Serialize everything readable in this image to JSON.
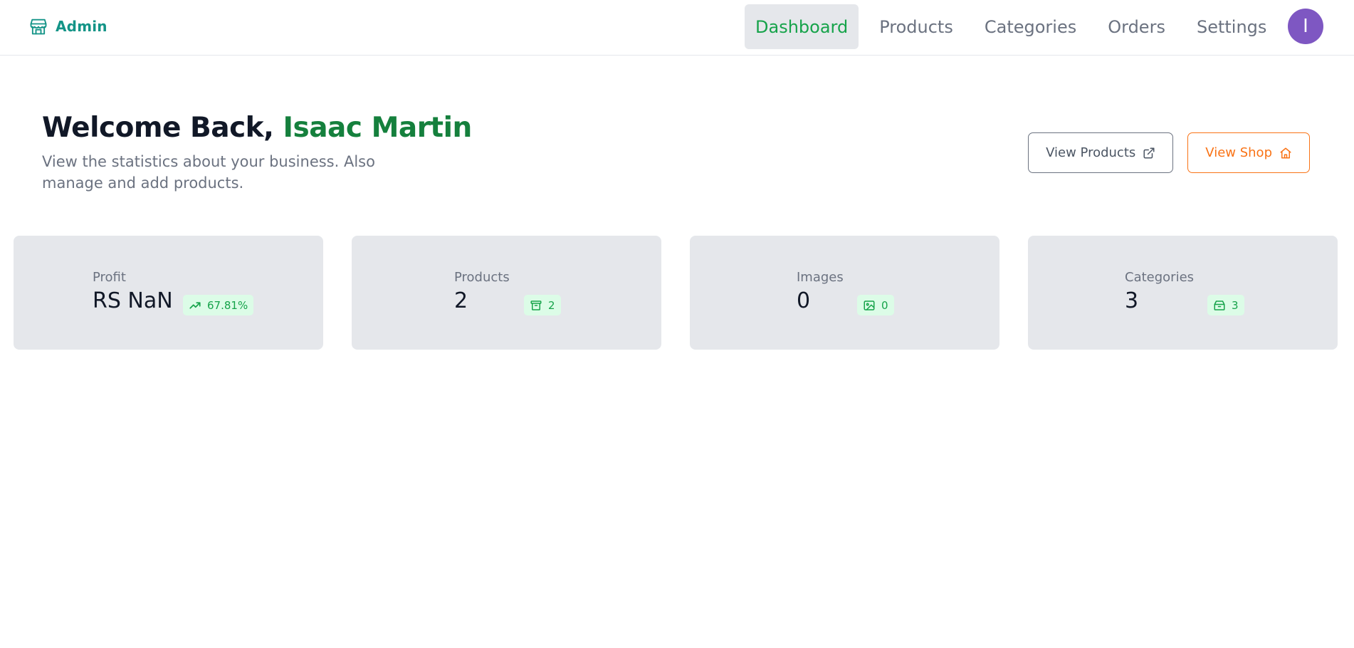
{
  "header": {
    "brand_label": "Admin",
    "brand_icon": "store-icon",
    "nav": [
      {
        "label": "Dashboard",
        "active": true
      },
      {
        "label": "Products",
        "active": false
      },
      {
        "label": "Categories",
        "active": false
      },
      {
        "label": "Orders",
        "active": false
      },
      {
        "label": "Settings",
        "active": false
      }
    ],
    "avatar_initial": "I"
  },
  "welcome": {
    "title_prefix": "Welcome Back, ",
    "user_name": "Isaac Martin",
    "subtitle": "View the statistics about your business. Also manage and add products."
  },
  "actions": {
    "view_products": {
      "label": "View Products",
      "icon": "external-link-icon"
    },
    "view_shop": {
      "label": "View Shop",
      "icon": "home-icon"
    }
  },
  "stats": [
    {
      "label": "Profit",
      "value": "RS NaN",
      "chip": "67.81%",
      "icon": "trending-up-icon"
    },
    {
      "label": "Products",
      "value": "2",
      "chip": "2",
      "icon": "archive-icon"
    },
    {
      "label": "Images",
      "value": "0",
      "chip": "0",
      "icon": "image-icon"
    },
    {
      "label": "Categories",
      "value": "3",
      "chip": "3",
      "icon": "package-icon"
    }
  ],
  "colors": {
    "brand": "#139487",
    "accent_green": "#16a34a",
    "name_green": "#15803d",
    "orange": "#f97316",
    "avatar": "#7e57c2",
    "card_bg": "#e5e7eb"
  }
}
